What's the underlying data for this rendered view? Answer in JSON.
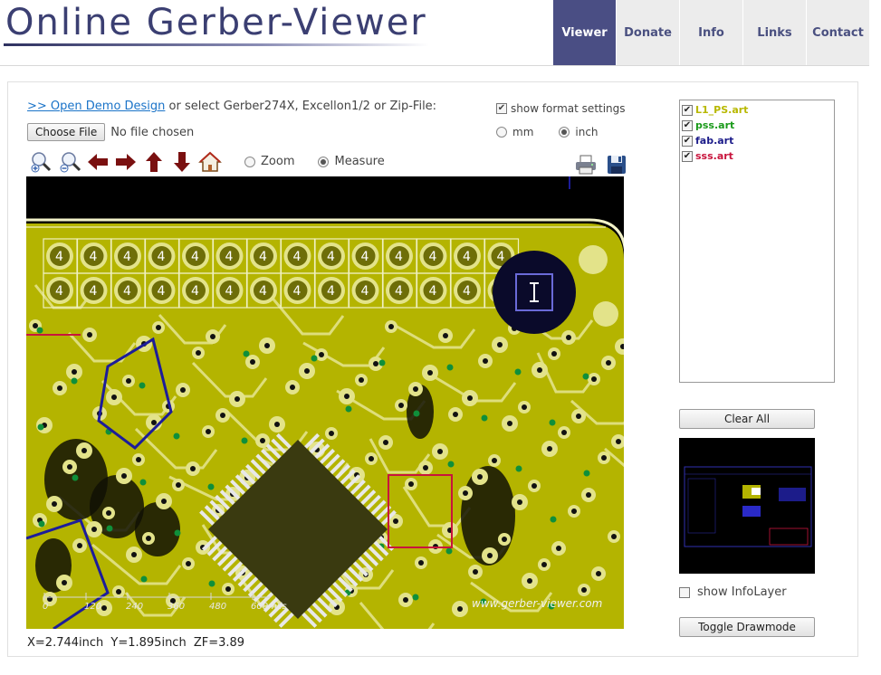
{
  "header": {
    "logo": "Online Gerber-Viewer",
    "tabs": [
      {
        "label": "Viewer",
        "active": true
      },
      {
        "label": "Donate",
        "active": false
      },
      {
        "label": "Info",
        "active": false
      },
      {
        "label": "Links",
        "active": false
      },
      {
        "label": "Contact",
        "active": false
      }
    ]
  },
  "open": {
    "demo_link": ">> Open Demo Design",
    "text": " or select Gerber274X, Excellon1/2 or Zip-File:",
    "choose_file_label": "Choose File",
    "no_file_text": "No file chosen"
  },
  "format": {
    "show_settings_label": "show format settings",
    "show_settings_checked": true,
    "unit_mm_label": "mm",
    "unit_inch_label": "inch",
    "selected_unit": "inch"
  },
  "toolbar": {
    "icons": [
      "zoom-in-icon",
      "zoom-out-icon",
      "arrow-left-icon",
      "arrow-right-icon",
      "arrow-up-icon",
      "arrow-down-icon",
      "home-icon"
    ],
    "mode_zoom_label": "Zoom",
    "mode_measure_label": "Measure",
    "selected_mode": "Measure",
    "right_icons": [
      "print-icon",
      "save-icon"
    ]
  },
  "canvas": {
    "scale_labels": [
      "0",
      "120",
      "240",
      "360",
      "480",
      "600mils"
    ],
    "watermark": "www.gerber-viewer.com",
    "colors": {
      "board": "#b4b400",
      "background": "#000000",
      "silk": "#ffffff",
      "pad": "#e3e38a",
      "drill": "#0f8f3a",
      "fab": "#1c1c9a",
      "sss": "#c8143c"
    }
  },
  "status": {
    "x": "X=2.744inch",
    "y": "Y=1.895inch",
    "zf": "ZF=3.89"
  },
  "layers": [
    {
      "name": "L1_PS.art",
      "color": "#b8b800",
      "checked": true
    },
    {
      "name": "pss.art",
      "color": "#1a9a1a",
      "checked": true
    },
    {
      "name": "fab.art",
      "color": "#1c1c8a",
      "checked": true
    },
    {
      "name": "sss.art",
      "color": "#c8143c",
      "checked": true
    }
  ],
  "buttons": {
    "clear_all": "Clear All",
    "toggle_drawmode": "Toggle Drawmode"
  },
  "infolayer": {
    "label": "show InfoLayer",
    "checked": false
  }
}
